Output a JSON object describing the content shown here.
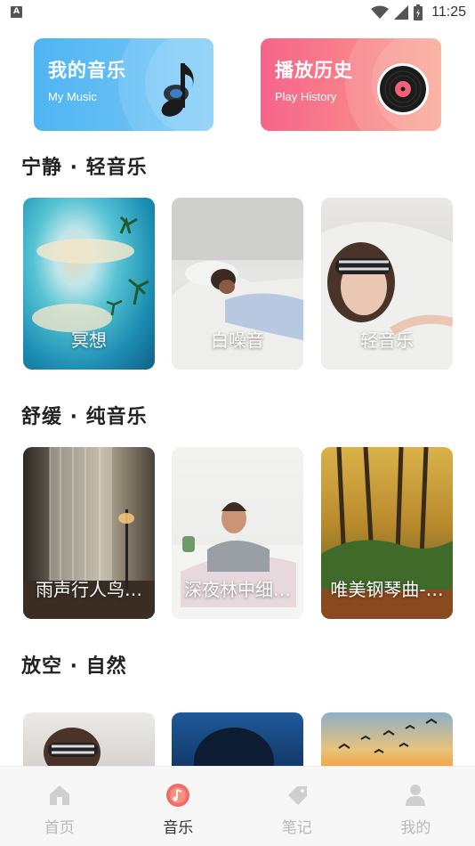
{
  "status_bar": {
    "time": "11:25",
    "left_badge": "A",
    "icons": [
      "wifi-icon",
      "signal-icon",
      "battery-icon"
    ]
  },
  "top_cards": [
    {
      "title": "我的音乐",
      "subtitle": "My Music",
      "icon": "music-note-icon",
      "color_from": "#4fb4f2",
      "color_to": "#7ac9f7"
    },
    {
      "title": "播放历史",
      "subtitle": "Play History",
      "icon": "vinyl-record-icon",
      "color_from": "#f6648a",
      "color_to": "#fa9f8a"
    }
  ],
  "sections": [
    {
      "title": "宁静 · 轻音乐",
      "tiles": [
        {
          "label": "冥想",
          "scene": "tropical-island"
        },
        {
          "label": "白噪音",
          "scene": "woman-sleeping-bed"
        },
        {
          "label": "轻音乐",
          "scene": "woman-eye-mask"
        }
      ]
    },
    {
      "title": "舒缓 · 纯音乐",
      "tiles": [
        {
          "label": "雨声行人鸟…",
          "scene": "curtain-window"
        },
        {
          "label": "深夜林中细…",
          "scene": "man-waking-up"
        },
        {
          "label": "唯美钢琴曲-…",
          "scene": "autumn-forest"
        }
      ]
    },
    {
      "title": "放空 · 自然",
      "tiles": [
        {
          "label": "",
          "scene": "eye-mask-sleep"
        },
        {
          "label": "",
          "scene": "blue-night"
        },
        {
          "label": "",
          "scene": "birds-sunset"
        }
      ]
    }
  ],
  "bottom_nav": [
    {
      "label": "首页",
      "icon": "home-icon",
      "active": false
    },
    {
      "label": "音乐",
      "icon": "music-disc-icon",
      "active": true
    },
    {
      "label": "笔记",
      "icon": "note-tag-icon",
      "active": false
    },
    {
      "label": "我的",
      "icon": "person-icon",
      "active": false
    }
  ],
  "colors": {
    "accent": "#f26a6a",
    "nav_inactive": "#b8b8b8",
    "nav_active_text": "#333333"
  }
}
